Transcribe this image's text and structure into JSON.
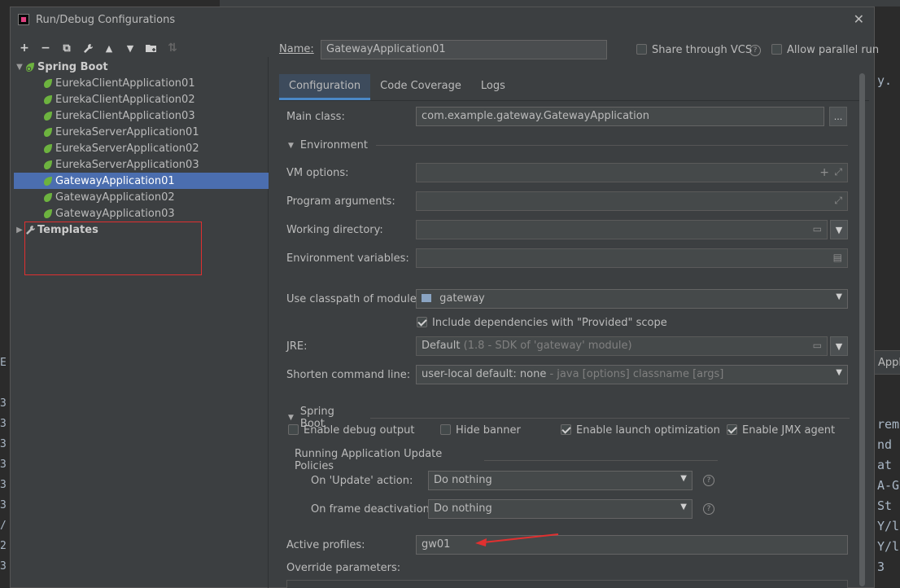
{
  "background": {
    "right_code_lines": [
      "y.",
      "rem",
      "nd",
      "at",
      "A-G",
      " St",
      "Y/l",
      "Y/l",
      "3"
    ],
    "right_tab": "Appli",
    "left_glyphs": [
      "E",
      "3",
      "3",
      "3",
      "3",
      "3",
      "3",
      "/",
      "2",
      "3"
    ]
  },
  "dialog": {
    "title": "Run/Debug Configurations",
    "close_glyph": "✕"
  },
  "toolbar": {
    "add": "+",
    "remove": "−",
    "copy": "⧉",
    "edit_defaults": "🔧",
    "move_up": "▲",
    "move_down": "▼",
    "new_folder": "📁",
    "sort": "⇅"
  },
  "tree": {
    "spring_boot": {
      "label": "Spring Boot",
      "expanded_glyph": "▼",
      "items": [
        {
          "label": "EurekaClientApplication01"
        },
        {
          "label": "EurekaClientApplication02"
        },
        {
          "label": "EurekaClientApplication03"
        },
        {
          "label": "EurekaServerApplication01"
        },
        {
          "label": "EurekaServerApplication02"
        },
        {
          "label": "EurekaServerApplication03"
        },
        {
          "label": "GatewayApplication01",
          "selected": true
        },
        {
          "label": "GatewayApplication02"
        },
        {
          "label": "GatewayApplication03"
        }
      ]
    },
    "templates": {
      "label": "Templates",
      "collapsed_glyph": "▶"
    }
  },
  "form": {
    "name_label": "Name:",
    "name_value": "GatewayApplication01",
    "share_vcs_label": "Share through VCS",
    "allow_parallel_label": "Allow parallel run",
    "tabs": [
      {
        "label": "Configuration",
        "active": true
      },
      {
        "label": "Code Coverage"
      },
      {
        "label": "Logs"
      }
    ],
    "main_class_label": "Main class:",
    "main_class_value": "com.example.gateway.GatewayApplication",
    "main_class_button": "...",
    "environment_section": "Environment",
    "vm_options_label": "VM options:",
    "program_args_label": "Program arguments:",
    "working_dir_label": "Working directory:",
    "env_vars_label": "Environment variables:",
    "classpath_label": "Use classpath of module:",
    "classpath_value": "gateway",
    "include_deps_label": "Include dependencies with \"Provided\" scope",
    "include_deps_checked": true,
    "jre_label": "JRE:",
    "jre_value": "Default",
    "jre_hint": "(1.8 - SDK of 'gateway' module)",
    "shorten_label": "Shorten command line:",
    "shorten_value": "user-local default: none",
    "shorten_hint": "- java [options] classname [args]",
    "spring_boot_section": "Spring Boot",
    "debug_output_label": "Enable debug output",
    "debug_output_checked": false,
    "hide_banner_label": "Hide banner",
    "hide_banner_checked": false,
    "launch_opt_label": "Enable launch optimization",
    "launch_opt_checked": true,
    "jmx_label": "Enable JMX agent",
    "jmx_checked": true,
    "update_policies_label": "Running Application Update Policies",
    "on_update_label": "On 'Update' action:",
    "on_update_value": "Do nothing",
    "on_frame_label": "On frame deactivation:",
    "on_frame_value": "Do nothing",
    "active_profiles_label": "Active profiles:",
    "active_profiles_value": "gw01",
    "override_params_label": "Override parameters:"
  },
  "colors": {
    "dialog_bg": "#3c3f41",
    "selection": "#4b6eaf",
    "annotation_red": "#e03030",
    "spring_green": "#6db33f"
  }
}
